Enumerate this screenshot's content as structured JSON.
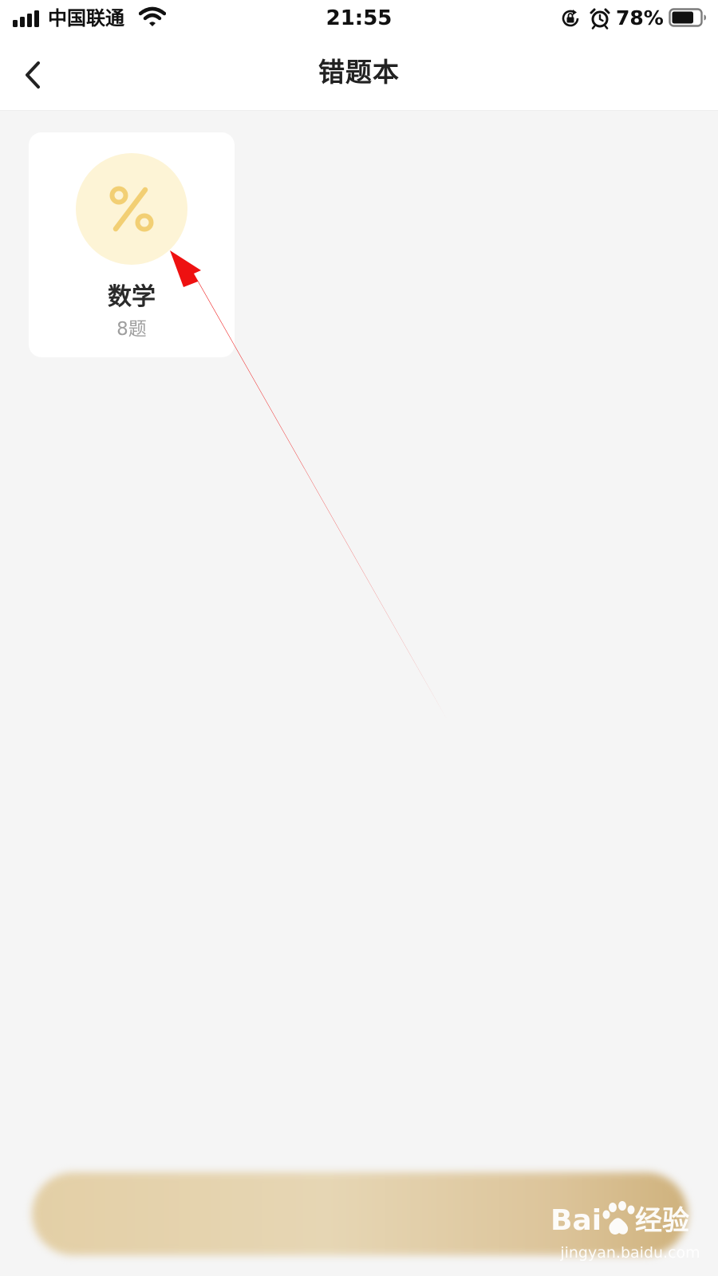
{
  "status_bar": {
    "carrier": "中国联通",
    "time": "21:55",
    "battery_percent": "78%",
    "battery_level": 0.78,
    "icons": [
      "signal-icon",
      "wifi-icon",
      "rotation-lock-icon",
      "alarm-icon",
      "battery-icon"
    ]
  },
  "nav": {
    "title": "错题本",
    "back_icon": "chevron-left-icon"
  },
  "subjects": [
    {
      "name": "数学",
      "count": "8题",
      "icon": "percent-icon",
      "icon_color": "#f2cf74",
      "icon_bg": "#fdf4d6"
    }
  ],
  "bottom_bar": {
    "text": "",
    "colors": [
      "#e3cfa6",
      "#cfb27d"
    ]
  },
  "annotation": {
    "arrow_color": "#ee1111"
  },
  "watermark": {
    "brand": "Baidu经验",
    "url": "jingyan.baidu.com"
  }
}
